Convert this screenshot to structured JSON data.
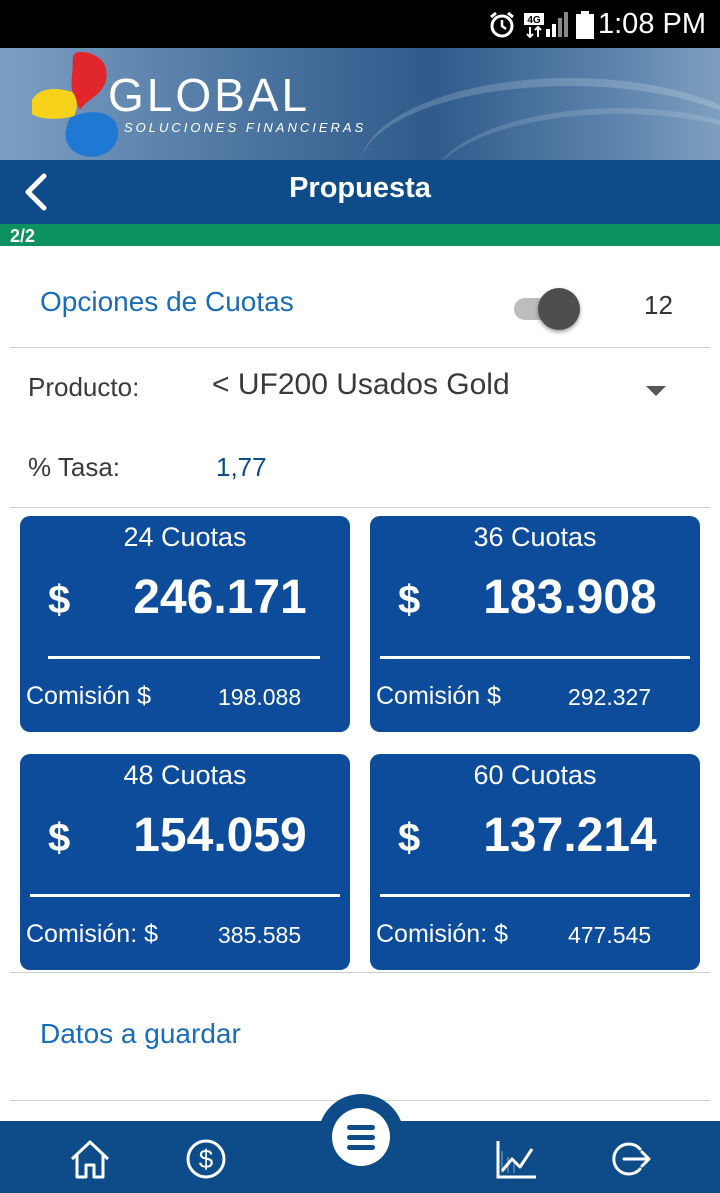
{
  "status_bar": {
    "time": "1:08 PM",
    "network": "4G"
  },
  "banner": {
    "brand": "GLOBAL",
    "tagline": "SOLUCIONES FINANCIERAS"
  },
  "header": {
    "title": "Propuesta"
  },
  "progress": {
    "label": "2/2",
    "value": 1.0
  },
  "options": {
    "label": "Opciones de Cuotas",
    "toggle_on": true,
    "value": "12"
  },
  "producto": {
    "label": "Producto:",
    "value": "< UF200 Usados Gold"
  },
  "tasa": {
    "label": "% Tasa:",
    "value": "1,77"
  },
  "cards": [
    {
      "title": "24 Cuotas",
      "currency": "$",
      "amount": "246.171",
      "commission_label": "Comisión  $",
      "commission": "198.088"
    },
    {
      "title": "36 Cuotas",
      "currency": "$",
      "amount": "183.908",
      "commission_label": "Comisión  $",
      "commission": "292.327"
    },
    {
      "title": "48 Cuotas",
      "currency": "$",
      "amount": "154.059",
      "commission_label": "Comisión: $",
      "commission": "385.585"
    },
    {
      "title": "60 Cuotas",
      "currency": "$",
      "amount": "137.214",
      "commission_label": "Comisión: $",
      "commission": "477.545"
    }
  ],
  "datos": {
    "label": "Datos a guardar"
  },
  "nav": {
    "icons": [
      "home-icon",
      "dollar-icon",
      "menu-icon",
      "chart-icon",
      "logout-icon"
    ]
  },
  "colors": {
    "primary": "#0d4c88",
    "card": "#0d4c9a",
    "accent_text": "#1a6cb6",
    "progress": "#0d9161"
  }
}
